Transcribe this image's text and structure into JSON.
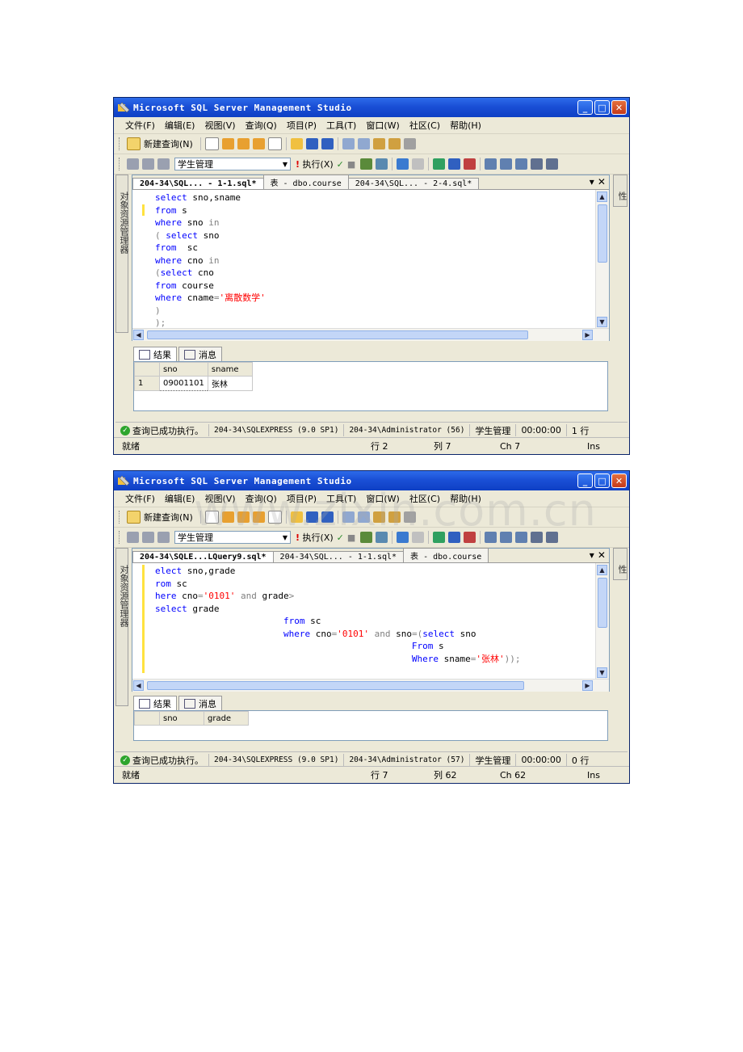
{
  "window_title": "Microsoft SQL Server Management Studio",
  "menu": [
    "文件(F)",
    "编辑(E)",
    "视图(V)",
    "查询(Q)",
    "项目(P)",
    "工具(T)",
    "窗口(W)",
    "社区(C)",
    "帮助(H)"
  ],
  "toolbar": {
    "new_query": "新建查询(N)",
    "database": "学生管理",
    "execute": "执行(X)"
  },
  "left_panel_label": "对象资源管理器",
  "right_panel_label": "属性",
  "result_tabs": {
    "results": "结果",
    "messages": "消息"
  },
  "ready": "就绪",
  "watermark": "www.zixin.com.cn",
  "windows": [
    {
      "tabs": [
        "204-34\\SQL... - 1-1.sql*",
        "表 - dbo.course",
        "204-34\\SQL... - 2-4.sql*"
      ],
      "code": [
        [
          {
            "t": "select",
            "c": "kw"
          },
          {
            "t": " sno,sname",
            "c": ""
          }
        ],
        [
          {
            "t": "from",
            "c": "kw"
          },
          {
            "t": " s",
            "c": ""
          }
        ],
        [
          {
            "t": "where",
            "c": "kw"
          },
          {
            "t": " sno ",
            "c": ""
          },
          {
            "t": "in",
            "c": "gr"
          }
        ],
        [
          {
            "t": "( ",
            "c": "gr"
          },
          {
            "t": "select",
            "c": "kw"
          },
          {
            "t": " sno",
            "c": ""
          }
        ],
        [
          {
            "t": "from",
            "c": "kw"
          },
          {
            "t": "  sc",
            "c": ""
          }
        ],
        [
          {
            "t": "where",
            "c": "kw"
          },
          {
            "t": " cno ",
            "c": ""
          },
          {
            "t": "in",
            "c": "gr"
          }
        ],
        [
          {
            "t": "(",
            "c": "gr"
          },
          {
            "t": "select",
            "c": "kw"
          },
          {
            "t": " cno",
            "c": ""
          }
        ],
        [
          {
            "t": "from",
            "c": "kw"
          },
          {
            "t": " course",
            "c": ""
          }
        ],
        [
          {
            "t": "where",
            "c": "kw"
          },
          {
            "t": " cname",
            "c": ""
          },
          {
            "t": "=",
            "c": "gr"
          },
          {
            "t": "'离散数学'",
            "c": "str"
          }
        ],
        [
          {
            "t": ")",
            "c": "gr"
          }
        ],
        [
          {
            "t": ");",
            "c": "gr"
          }
        ]
      ],
      "result_columns": [
        "sno",
        "sname"
      ],
      "result_rows": [
        [
          "1",
          "09001101",
          "张林"
        ]
      ],
      "status": {
        "message": "查询已成功执行。",
        "server": "204-34\\SQLEXPRESS (9.0 SP1)",
        "user": "204-34\\Administrator (56)",
        "db": "学生管理",
        "time": "00:00:00",
        "rows": "1 行"
      },
      "ready_pos": {
        "line": "行 2",
        "col": "列 7",
        "ch": "Ch 7",
        "ins": "Ins"
      }
    },
    {
      "tabs": [
        "204-34\\SQLE...LQuery9.sql*",
        "204-34\\SQL... - 1-1.sql*",
        "表 - dbo.course"
      ],
      "code": [
        [
          {
            "t": "elect",
            "c": "kw"
          },
          {
            "t": " sno,grade",
            "c": ""
          }
        ],
        [
          {
            "t": "rom",
            "c": "kw"
          },
          {
            "t": " sc",
            "c": ""
          }
        ],
        [
          {
            "t": "here",
            "c": "kw"
          },
          {
            "t": " cno",
            "c": ""
          },
          {
            "t": "=",
            "c": "gr"
          },
          {
            "t": "'0101'",
            "c": "str"
          },
          {
            "t": " and ",
            "c": "gr"
          },
          {
            "t": "grade",
            "c": ""
          },
          {
            "t": ">",
            "c": "gr"
          }
        ],
        [
          {
            "t": "select",
            "c": "kw"
          },
          {
            "t": " grade",
            "c": ""
          }
        ],
        [
          {
            "t": "                        ",
            "c": ""
          },
          {
            "t": "from",
            "c": "kw"
          },
          {
            "t": " sc",
            "c": ""
          }
        ],
        [
          {
            "t": "                        ",
            "c": ""
          },
          {
            "t": "where",
            "c": "kw"
          },
          {
            "t": " cno",
            "c": ""
          },
          {
            "t": "=",
            "c": "gr"
          },
          {
            "t": "'0101'",
            "c": "str"
          },
          {
            "t": " and ",
            "c": "gr"
          },
          {
            "t": "sno",
            "c": ""
          },
          {
            "t": "=(",
            "c": "gr"
          },
          {
            "t": "select",
            "c": "kw"
          },
          {
            "t": " sno",
            "c": ""
          }
        ],
        [
          {
            "t": "                                                ",
            "c": ""
          },
          {
            "t": "From",
            "c": "kw"
          },
          {
            "t": " s",
            "c": ""
          }
        ],
        [
          {
            "t": "                                                ",
            "c": ""
          },
          {
            "t": "Where",
            "c": "kw"
          },
          {
            "t": " sname",
            "c": ""
          },
          {
            "t": "=",
            "c": "gr"
          },
          {
            "t": "'张林'",
            "c": "str"
          },
          {
            "t": "));",
            "c": "gr"
          }
        ]
      ],
      "result_columns": [
        "sno",
        "grade"
      ],
      "result_rows": [],
      "status": {
        "message": "查询已成功执行。",
        "server": "204-34\\SQLEXPRESS (9.0 SP1)",
        "user": "204-34\\Administrator (57)",
        "db": "学生管理",
        "time": "00:00:00",
        "rows": "0 行"
      },
      "ready_pos": {
        "line": "行 7",
        "col": "列 62",
        "ch": "Ch 62",
        "ins": "Ins"
      }
    }
  ]
}
